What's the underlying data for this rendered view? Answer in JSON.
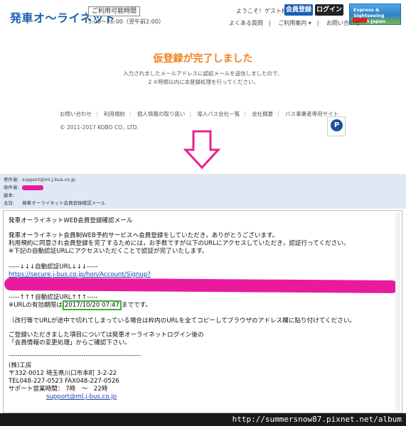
{
  "header": {
    "logo": "発車オ～ライネット",
    "hours_label": "ご利用可能時間",
    "hours": "5:00～26:00（翌午前2:00）",
    "welcome": "ようこそ！ゲスト様",
    "register_button": "会員登録",
    "login_button": "ログイン",
    "banner_line1": "Express & Sightseeing",
    "banner_line2": "bus in Japan",
    "subnav": [
      "よくある質問",
      "ご利用案内 ▾",
      "お問い合わせ"
    ]
  },
  "main": {
    "title": "仮登録が完了しました",
    "desc_line1": "入力されましたメールアドレスに認証メールを送信しましたので、",
    "desc_line2": "２４時間以内に本登録処理を行ってください。"
  },
  "footer": {
    "links": [
      "お問い合わせ",
      "利用規約",
      "個人情報の取り扱い",
      "導入バス会社一覧",
      "会社概要",
      "バス事業者専用サイト"
    ],
    "copyright": "© 2011-2017 KOBO CO., LTD.",
    "pmark": "P"
  },
  "mail_header": {
    "from_label": "寄件者:",
    "from_value": "support@ml.j-bus.co.jp",
    "to_label": "收件者:",
    "cc_label": "副本:",
    "subject_label": "主旨:",
    "subject_value": "発車オーライネット会員登録確認メール"
  },
  "mail_body": {
    "line1": "発車オーライネットWEB会員登録確認メール",
    "line2": "発車オーライネット会員制WEB予約サービスへ会員登録をしていただき，ありがとうございます。",
    "line3": "利用規約に同意され会員登録を完了するためには，お手数ですが以下のURLにアクセスしていただき，認証行ってください。",
    "line4": "※下記の自動認証URLにアクセスいただくことで認証が完了いたします。",
    "line5": "-----↓↓↓自動認証URL↓↓↓-----",
    "url": "https://secure.j-bus.co.jp/hon/Account/Signup?",
    "line6": "-----↑↑↑自動認証URL↑↑↑-----",
    "line7_pre": "※URLの有効期限は",
    "expiry": "2017/10/20 07:47",
    "line7_post": "までです。",
    "line8": "（改行等でURLが途中で切れてしまっている場合は枠内のURLを全てコピーしてブラウザのアドレス欄に貼り付けてください。",
    "line9": "ご登録いただきました項目については発車オーライネットログイン後の",
    "line10": "「会員情報の変更処理」からご確認下さい。",
    "divider": "------------------------------------------------------------",
    "company": "(株)工房",
    "address": "〒332-0012 埼玉県川口市本町 3-2-22",
    "tel": "TEL048-227-0523 FAX048-227-0526",
    "support_hours": "サポート営業時間： 7時　～　22時",
    "support_email": "support@ml.j-bus.co.jp"
  },
  "watermark": "http://summersnow87.pixnet.net/album",
  "colors": {
    "accent_orange": "#f0811a",
    "brand_blue": "#1a5fb4",
    "redaction_pink": "#ea1a9c",
    "highlight_green": "#3cb338"
  }
}
